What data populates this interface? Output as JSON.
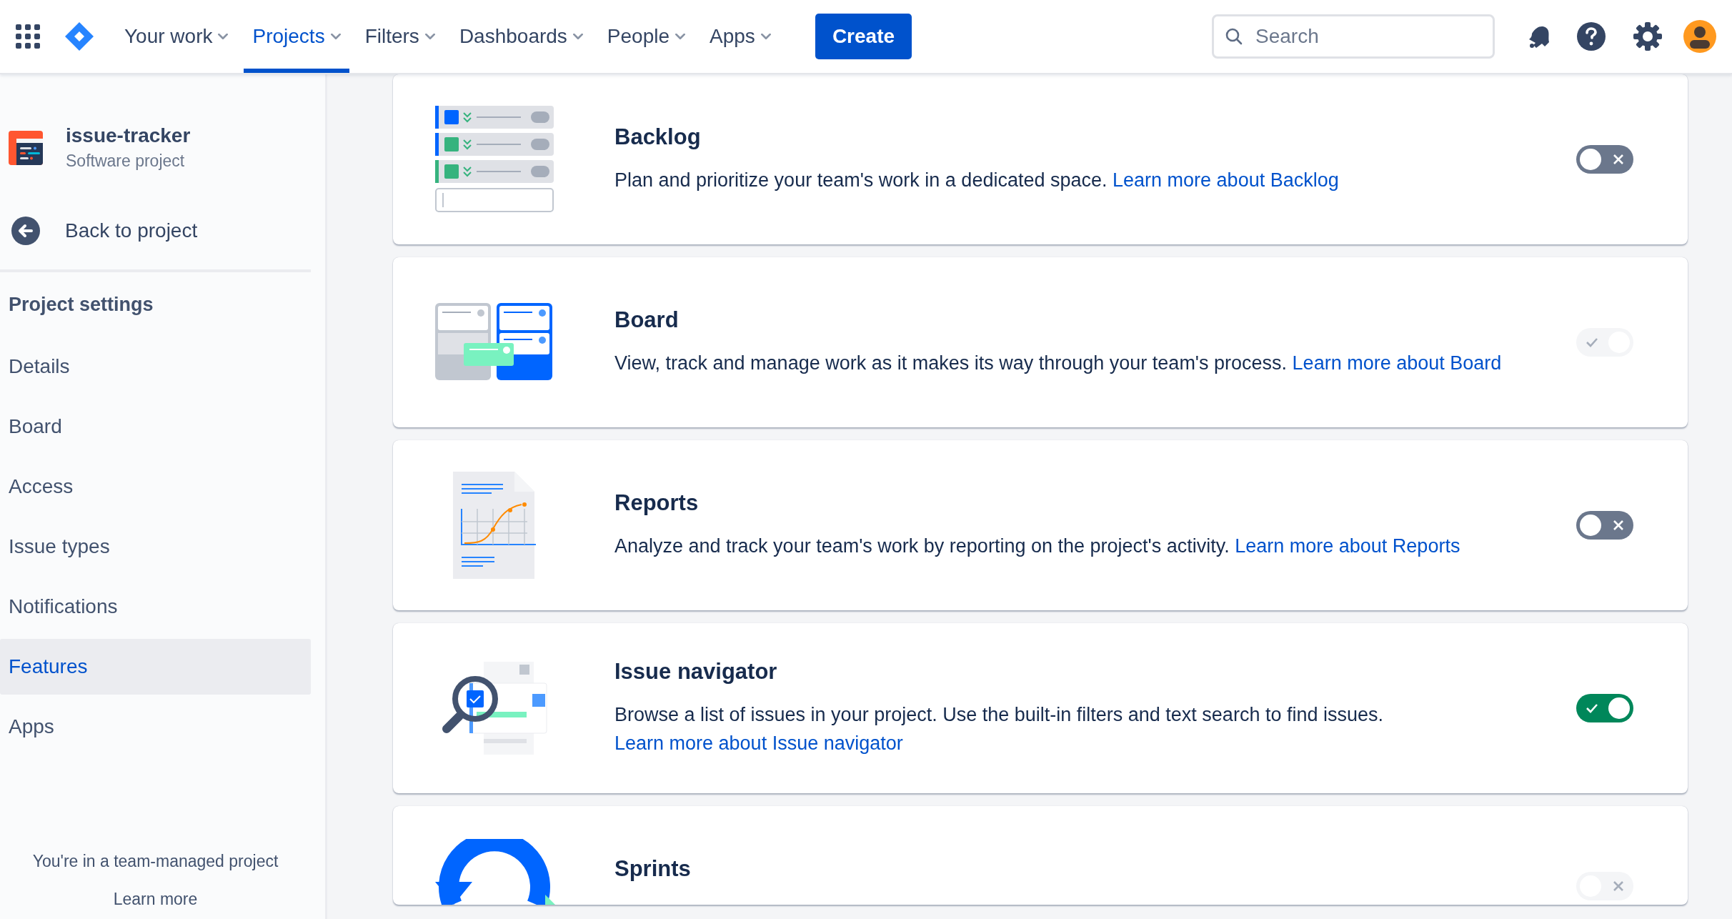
{
  "topbar": {
    "nav": [
      {
        "label": "Your work",
        "selected": false
      },
      {
        "label": "Projects",
        "selected": true
      },
      {
        "label": "Filters",
        "selected": false
      },
      {
        "label": "Dashboards",
        "selected": false
      },
      {
        "label": "People",
        "selected": false
      },
      {
        "label": "Apps",
        "selected": false
      }
    ],
    "create_button": "Create",
    "search": {
      "placeholder": "Search"
    }
  },
  "sidebar": {
    "project": {
      "name": "issue-tracker",
      "type": "Software project"
    },
    "back_link": "Back to project",
    "heading": "Project settings",
    "items": [
      {
        "label": "Details",
        "selected": false
      },
      {
        "label": "Board",
        "selected": false
      },
      {
        "label": "Access",
        "selected": false
      },
      {
        "label": "Issue types",
        "selected": false
      },
      {
        "label": "Notifications",
        "selected": false
      },
      {
        "label": "Features",
        "selected": true
      },
      {
        "label": "Apps",
        "selected": false
      }
    ],
    "footer": {
      "text": "You're in a team-managed project",
      "link": "Learn more"
    }
  },
  "features": [
    {
      "kind": "backlog",
      "title": "Backlog",
      "description": "Plan and prioritize your team's work in a dedicated space.",
      "link": "Learn more about Backlog",
      "on": false,
      "disabled": false
    },
    {
      "kind": "board",
      "title": "Board",
      "description": "View, track and manage work as it makes its way through your team's process.",
      "link": "Learn more about Board",
      "on": true,
      "disabled": true
    },
    {
      "kind": "reports",
      "title": "Reports",
      "description": "Analyze and track your team's work by reporting on the project's activity.",
      "link": "Learn more about Reports",
      "on": false,
      "disabled": false
    },
    {
      "kind": "navigator",
      "title": "Issue navigator",
      "description": "Browse a list of issues in your project. Use the built-in filters and text search to find issues.",
      "link": "Learn more about Issue navigator",
      "on": true,
      "disabled": false
    },
    {
      "kind": "sprints",
      "title": "Sprints",
      "on": false,
      "disabled": true
    }
  ]
}
